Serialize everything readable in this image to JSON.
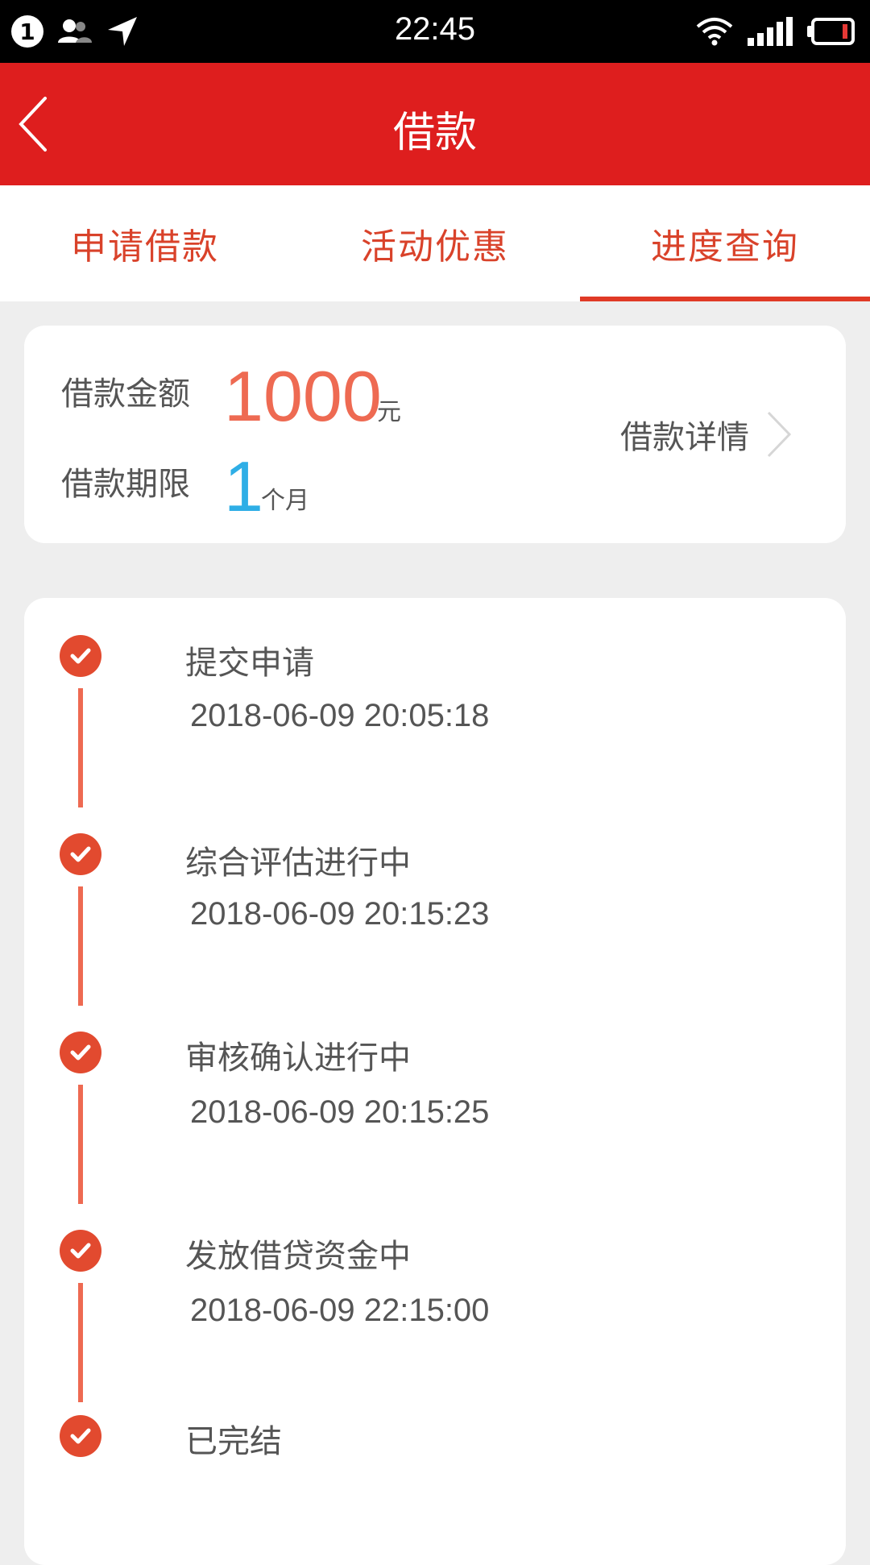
{
  "status_bar": {
    "notification_count": "1",
    "time": "22:45",
    "icons": [
      "contacts-icon",
      "location-arrow-icon",
      "wifi-icon",
      "signal-icon",
      "battery-icon"
    ]
  },
  "header": {
    "title": "借款",
    "back_icon": "chevron-left-icon"
  },
  "tabs": [
    {
      "label": "申请借款",
      "active": false
    },
    {
      "label": "活动优惠",
      "active": false
    },
    {
      "label": "进度查询",
      "active": true
    }
  ],
  "loan": {
    "amount_label": "借款金额",
    "amount_value": "1000",
    "amount_unit": "元",
    "term_label": "借款期限",
    "term_value": "1",
    "term_unit": "个月",
    "detail_link": "借款详情"
  },
  "progress": {
    "steps": [
      {
        "title": "提交申请",
        "time": "2018-06-09 20:05:18"
      },
      {
        "title": "综合评估进行中",
        "time": "2018-06-09 20:15:23"
      },
      {
        "title": "审核确认进行中",
        "time": "2018-06-09 20:15:25"
      },
      {
        "title": "发放借贷资金中",
        "time": "2018-06-09 22:15:00"
      },
      {
        "title": "已完结",
        "time": ""
      }
    ]
  },
  "colors": {
    "header_bg": "#de1e1e",
    "accent": "#e03a26",
    "amount": "#ee6a52",
    "term": "#2eaee6",
    "background": "#eeeeee"
  }
}
